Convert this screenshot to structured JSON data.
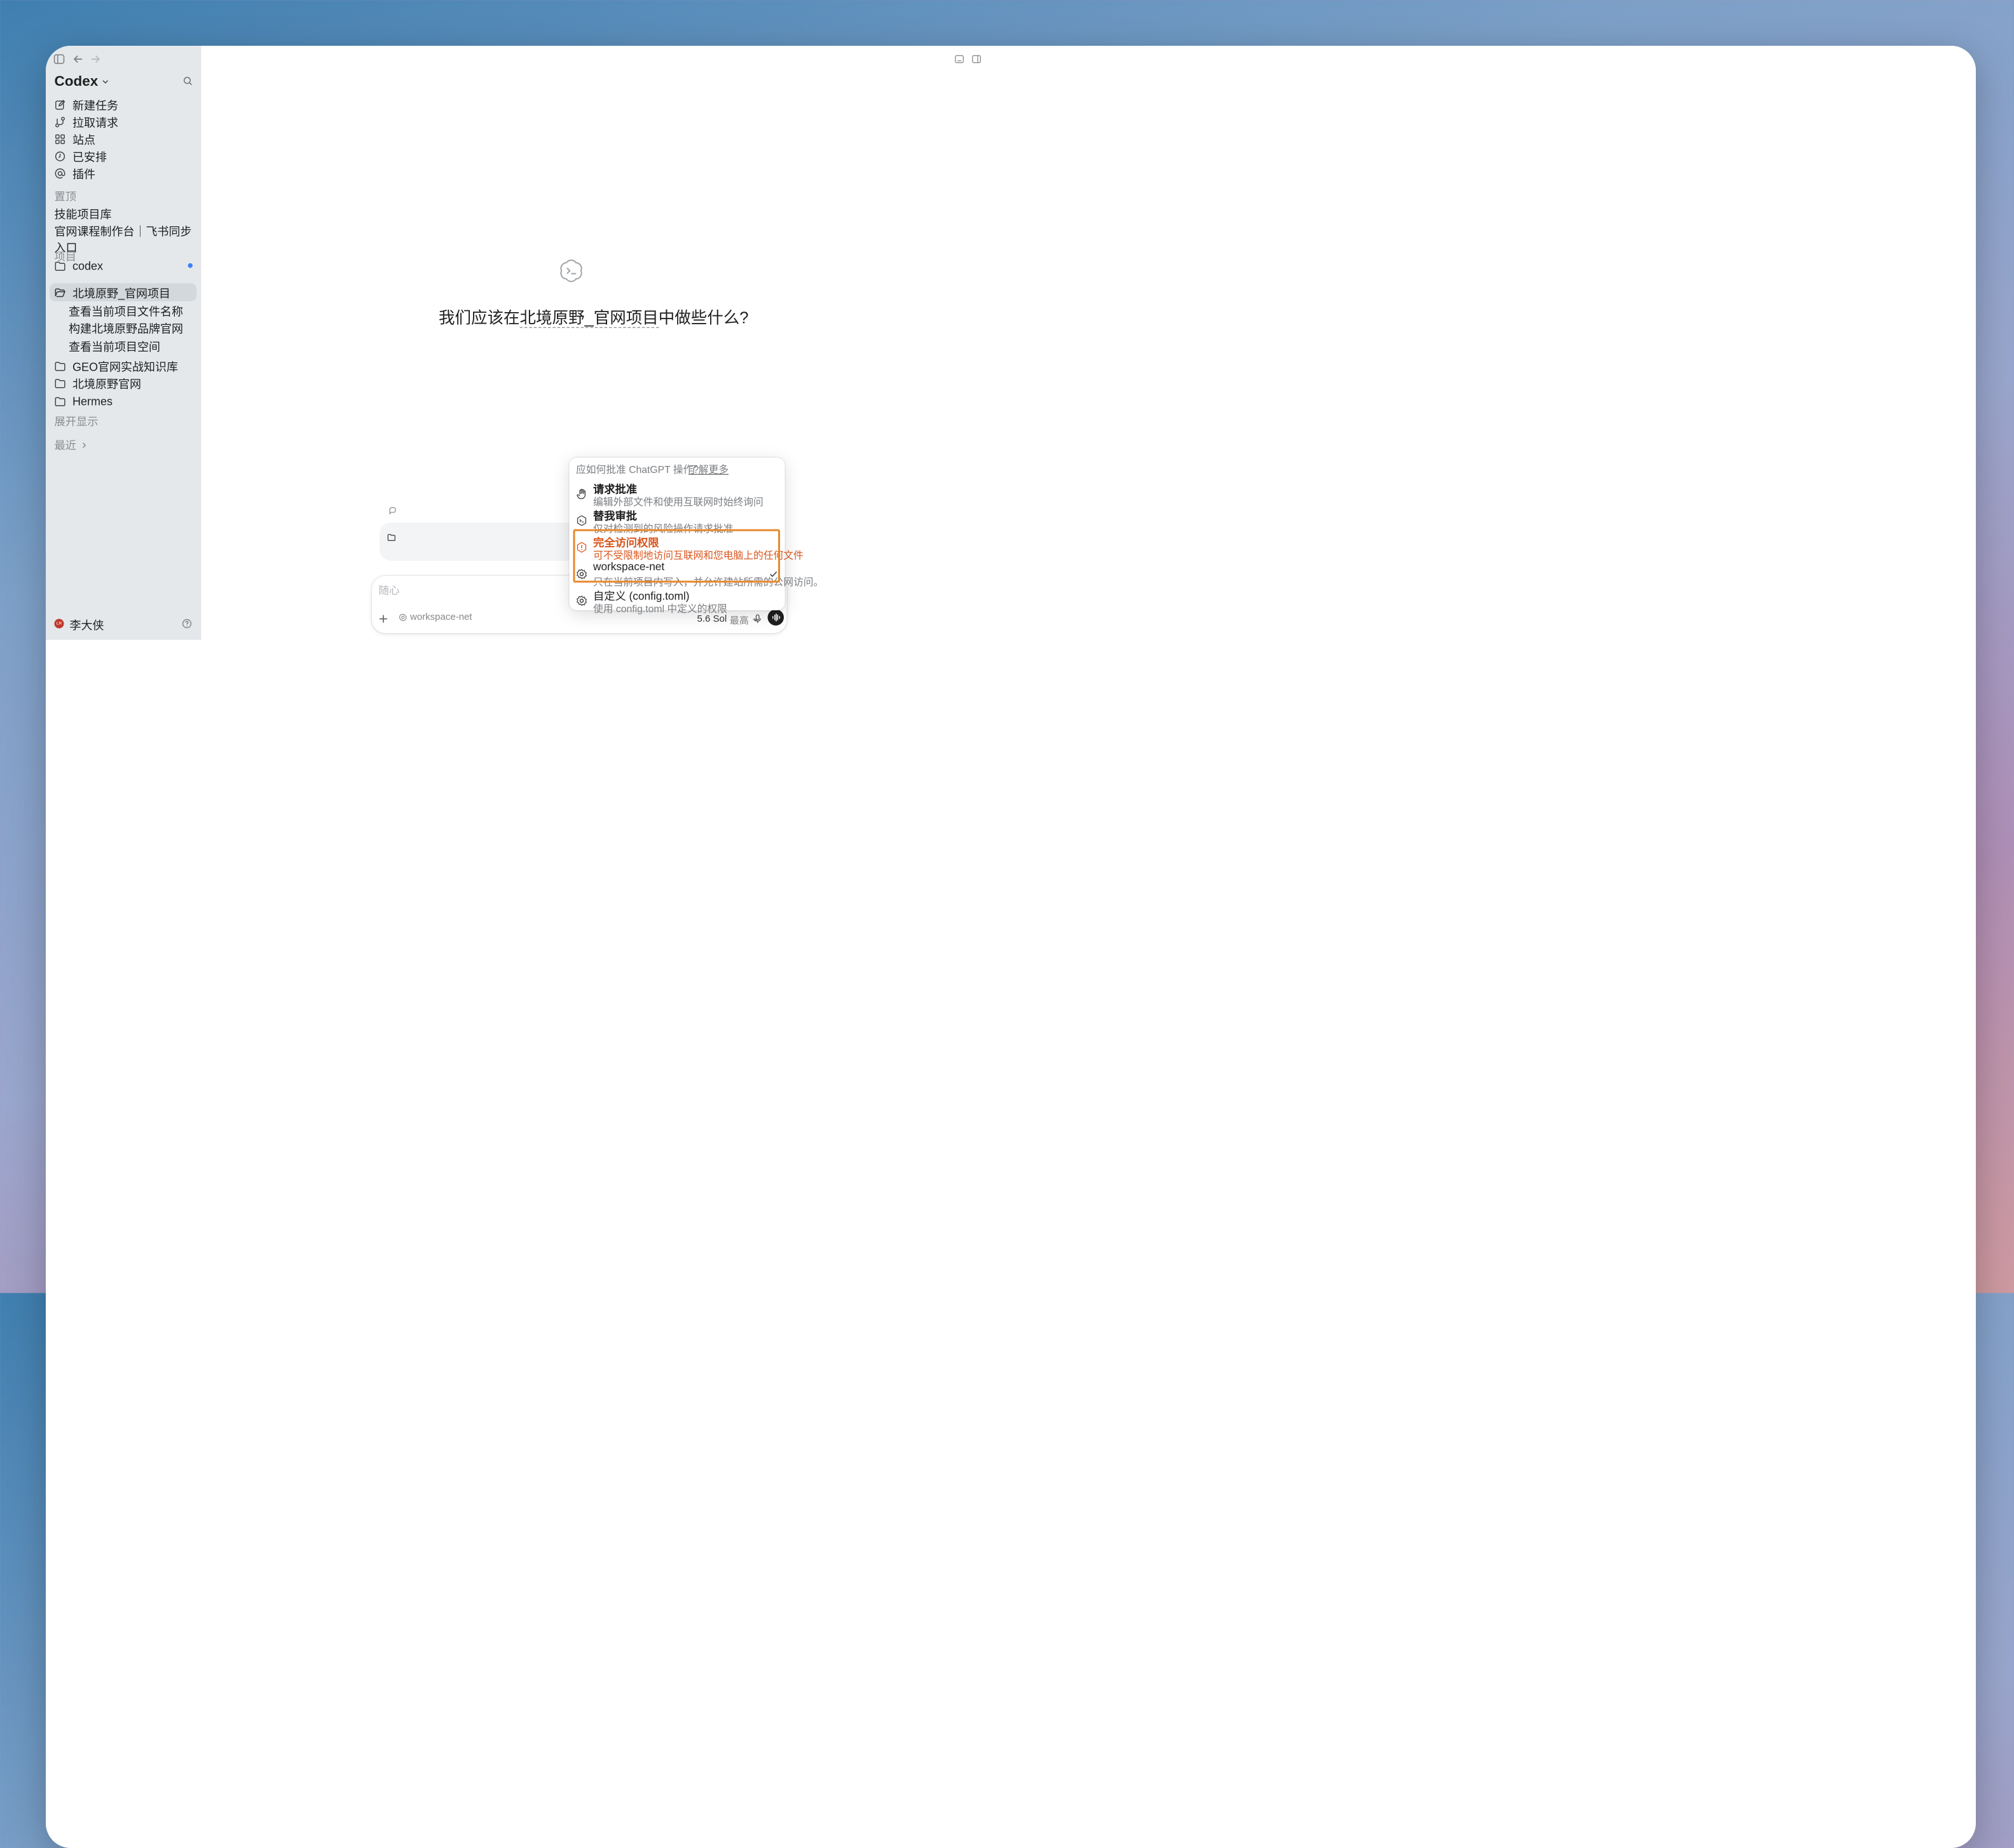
{
  "sidebar": {
    "app_title": "Codex",
    "nav": [
      {
        "label": "新建任务",
        "icon": "edit-icon"
      },
      {
        "label": "拉取请求",
        "icon": "pull-request-icon"
      },
      {
        "label": "站点",
        "icon": "grid-icon"
      },
      {
        "label": "已安排",
        "icon": "clock-icon"
      },
      {
        "label": "插件",
        "icon": "at-icon"
      }
    ],
    "pinned_heading": "置顶",
    "pinned": [
      "技能项目库",
      "官网课程制作台｜飞书同步入口"
    ],
    "projects_heading": "项目",
    "projects": [
      {
        "label": "codex",
        "unread": true
      },
      {
        "label": "北境原野_官网项目",
        "active": true,
        "children": [
          "查看当前项目文件名称",
          "构建北境原野品牌官网",
          "查看当前项目空间"
        ]
      },
      {
        "label": "GEO官网实战知识库"
      },
      {
        "label": "北境原野官网"
      },
      {
        "label": "Hermes"
      }
    ],
    "expand_label": "展开显示",
    "recent_label": "最近",
    "user": {
      "name": "李大侠",
      "initials": "LR",
      "avatar_color": "#c0392b"
    }
  },
  "main": {
    "headline_prefix": "我们应该在",
    "headline_project": "北境原野_官网项目",
    "headline_suffix": "中做些什么?"
  },
  "permission_popup": {
    "header": "应如何批准 ChatGPT 操作?",
    "learn_more": "了解更多",
    "options": [
      {
        "title": "请求批准",
        "desc": "编辑外部文件和使用互联网时始终询问",
        "icon": "hand-icon"
      },
      {
        "title": "替我审批",
        "desc": "仅对检测到的风险操作请求批准",
        "icon": "shield-terminal-icon"
      },
      {
        "title": "完全访问权限",
        "desc": "可不受限制地访问互联网和您电脑上的任何文件",
        "icon": "warning-shield-icon",
        "warning": true
      },
      {
        "title": "workspace-net",
        "desc": "只在当前项目内写入，并允许建站所需的公网访问。",
        "icon": "gear-icon",
        "selected": true
      },
      {
        "title": "自定义 (config.toml)",
        "desc": "使用 config.toml 中定义的权限",
        "icon": "gear-icon"
      }
    ],
    "highlight_color": "#e8882c",
    "warning_color": "#d9561e"
  },
  "composer": {
    "placeholder": "随心",
    "permission_chip": "workspace-net",
    "model": "5.6 Sol",
    "effort": "最高"
  },
  "colors": {
    "accent_blue": "#3b82f6",
    "sidebar_bg": "#e4e8eb"
  }
}
